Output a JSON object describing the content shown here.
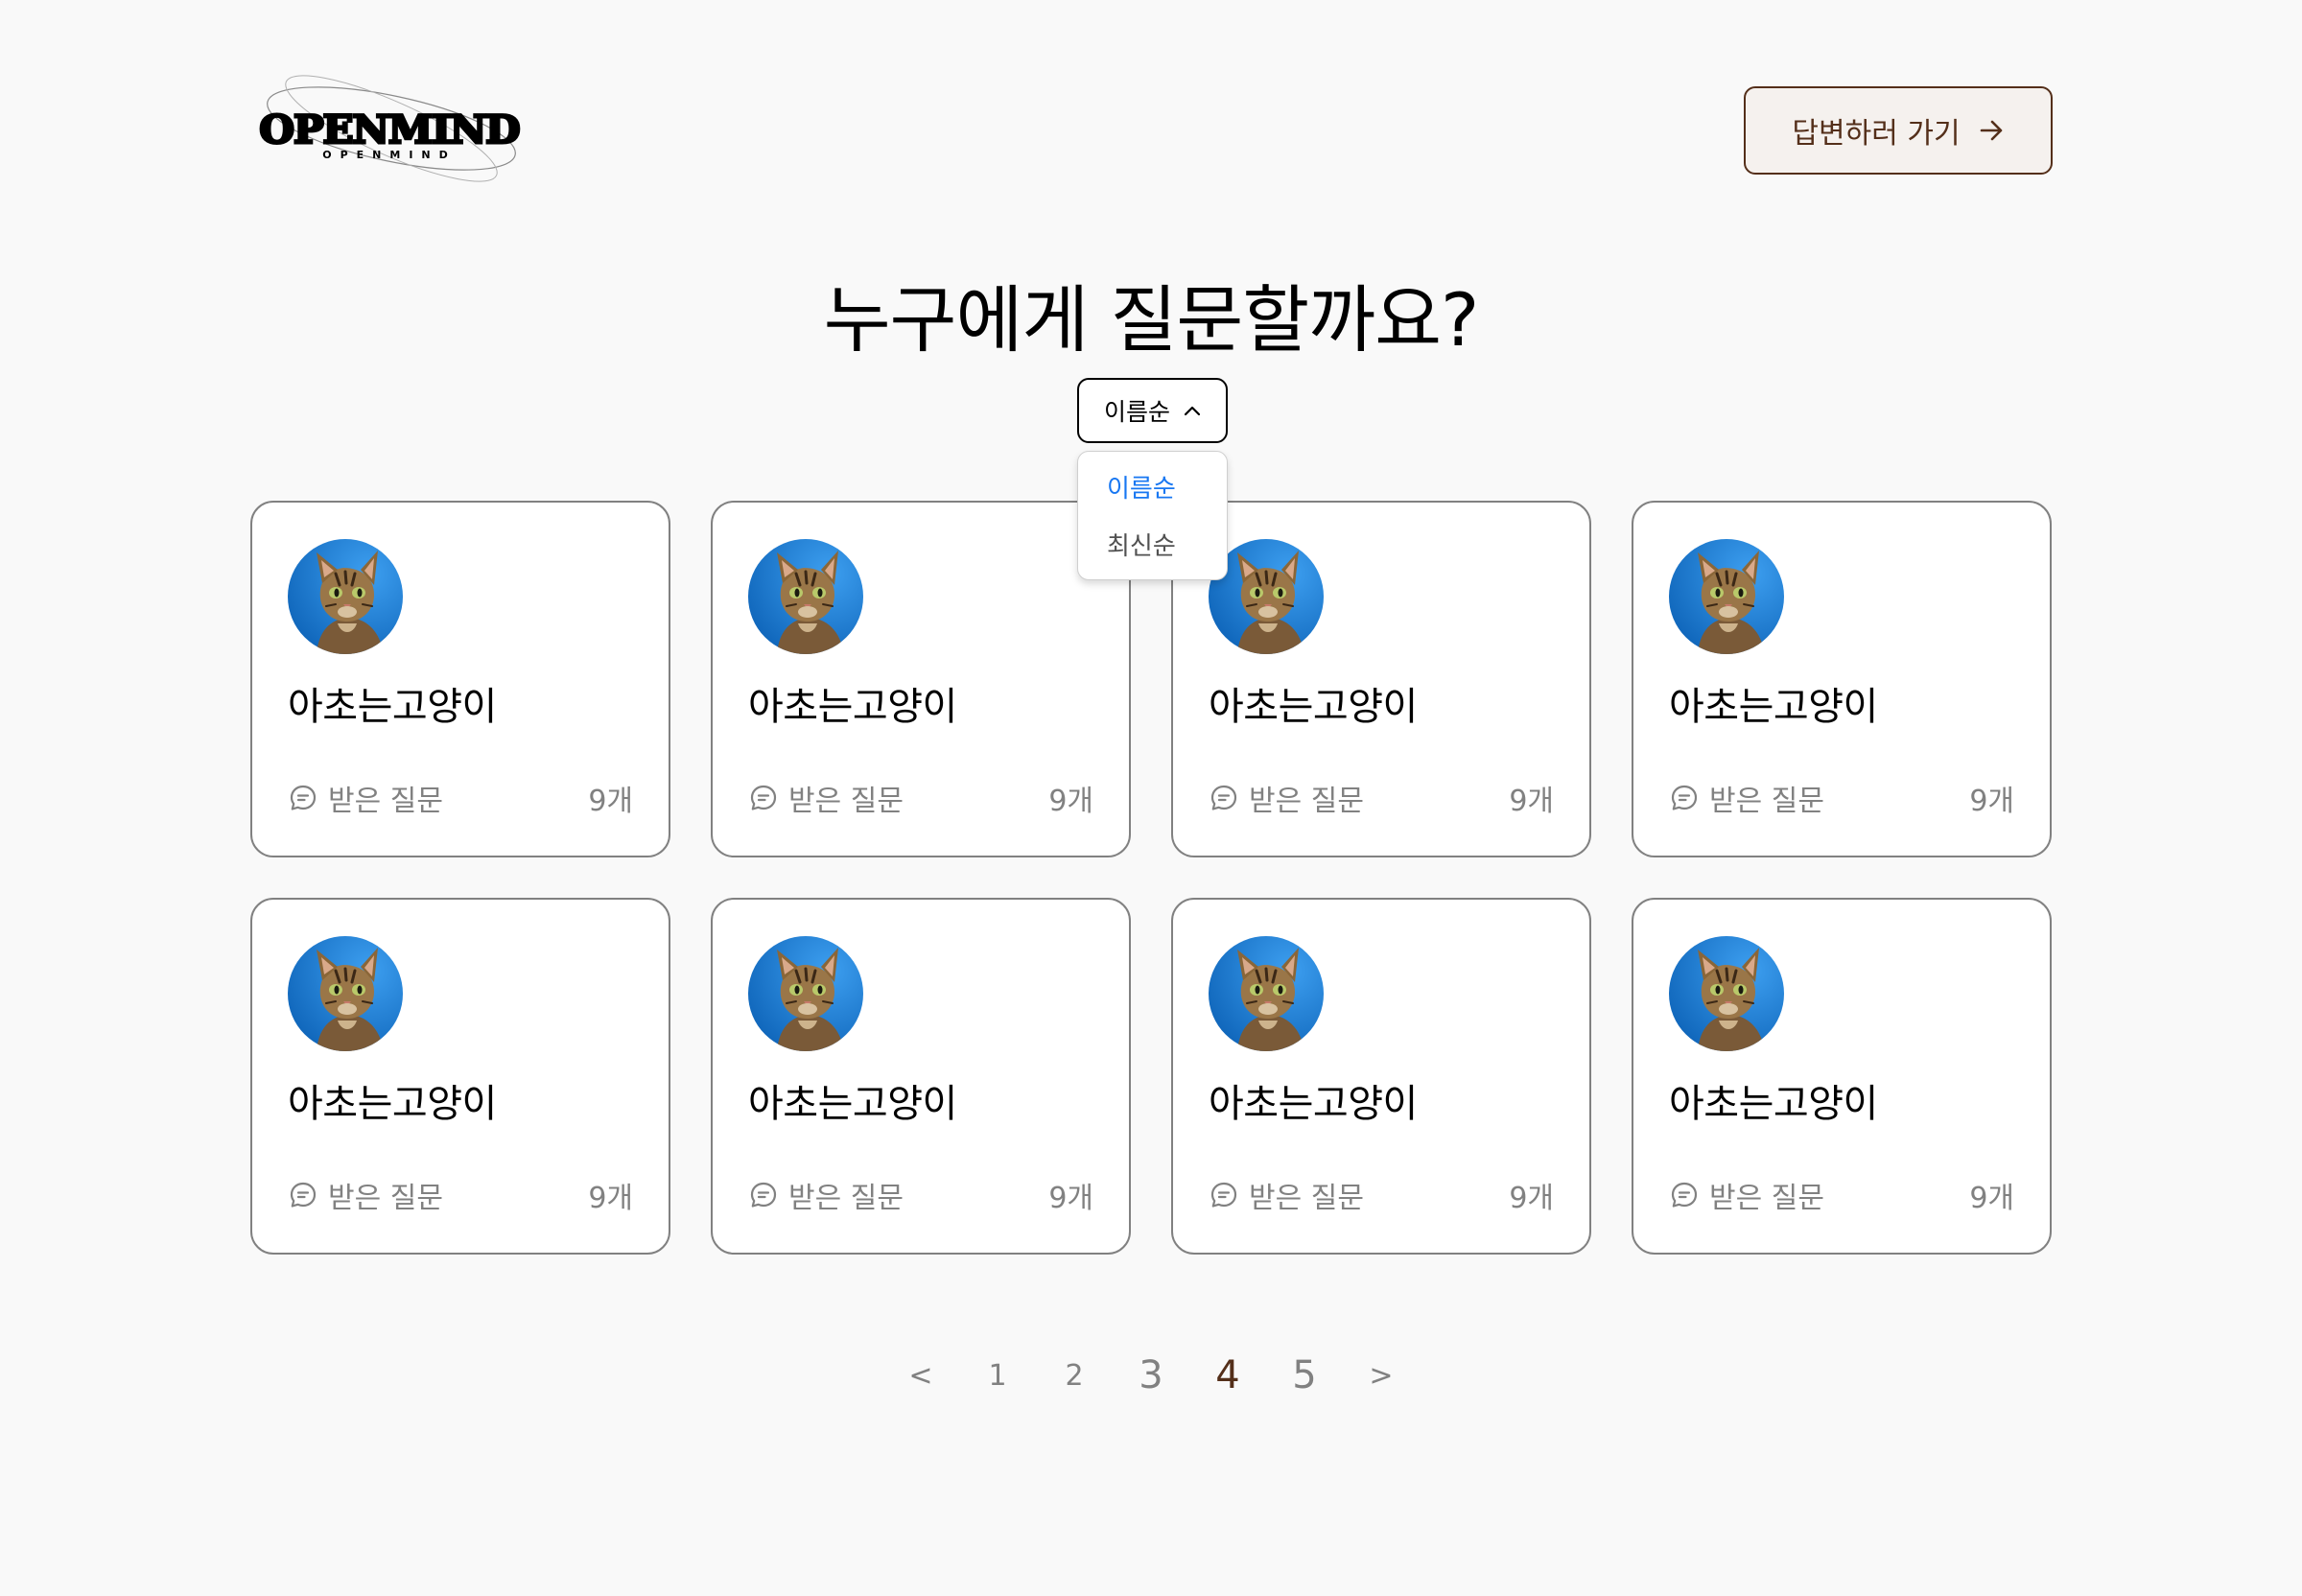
{
  "header": {
    "logo_text": "OPENMIND",
    "logo_subtext": "OPENMIND",
    "answer_button_label": "답변하러 가기"
  },
  "main": {
    "title": "누구에게 질문할까요?",
    "sort": {
      "selected": "이름순",
      "options": [
        "이름순",
        "최신순"
      ]
    },
    "cards": [
      {
        "name": "아초는고양이",
        "questions_label": "받은 질문",
        "count": "9개"
      },
      {
        "name": "아초는고양이",
        "questions_label": "받은 질문",
        "count": "9개"
      },
      {
        "name": "아초는고양이",
        "questions_label": "받은 질문",
        "count": "9개"
      },
      {
        "name": "아초는고양이",
        "questions_label": "받은 질문",
        "count": "9개"
      },
      {
        "name": "아초는고양이",
        "questions_label": "받은 질문",
        "count": "9개"
      },
      {
        "name": "아초는고양이",
        "questions_label": "받은 질문",
        "count": "9개"
      },
      {
        "name": "아초는고양이",
        "questions_label": "받은 질문",
        "count": "9개"
      },
      {
        "name": "아초는고양이",
        "questions_label": "받은 질문",
        "count": "9개"
      }
    ]
  },
  "pagination": {
    "prev": "<",
    "pages": [
      "1",
      "2",
      "3",
      "4",
      "5"
    ],
    "current": "4",
    "next": ">"
  },
  "colors": {
    "background": "#f9f9f9",
    "brown": "#542f1a",
    "accent_blue": "#1877f2",
    "gray": "#818181"
  }
}
